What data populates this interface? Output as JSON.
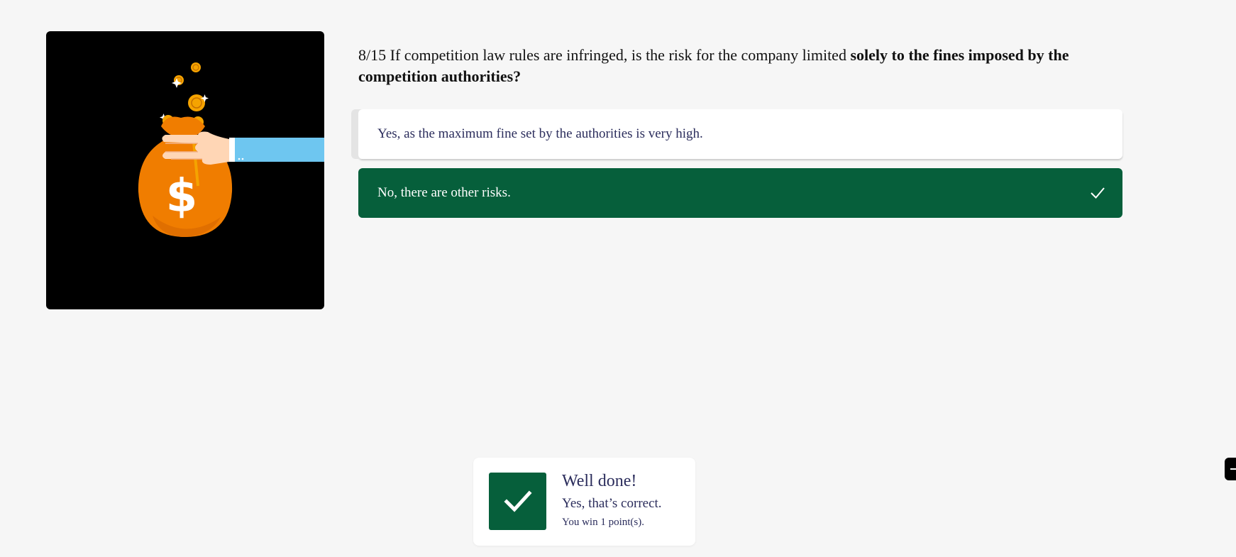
{
  "question": {
    "number": "8/15",
    "text": "If competition law rules are infringed, is the risk for the company limited",
    "emphasis": "solely to the fines imposed by the competition authorities?"
  },
  "illustration": {
    "icon": "money-bag-hand-icon",
    "colors": {
      "background": "#000000",
      "bag": "#f07d00",
      "sleeve": "#6ec6f0",
      "coin": "#f5a300"
    }
  },
  "answers": [
    {
      "label": "Yes, as the maximum fine set by the authorities is very high.",
      "state": "unselected"
    },
    {
      "label": "No, there are other risks.",
      "state": "correct-selected",
      "icon": "checkmark-icon"
    }
  ],
  "feedback": {
    "icon": "checkmark-icon",
    "title": "Well done!",
    "message": "Yes, that’s correct.",
    "points": "You win 1 point(s)."
  },
  "colors": {
    "accent": "#065f3b",
    "text": "#2b2d5c",
    "page_background": "#f6f6f6"
  }
}
